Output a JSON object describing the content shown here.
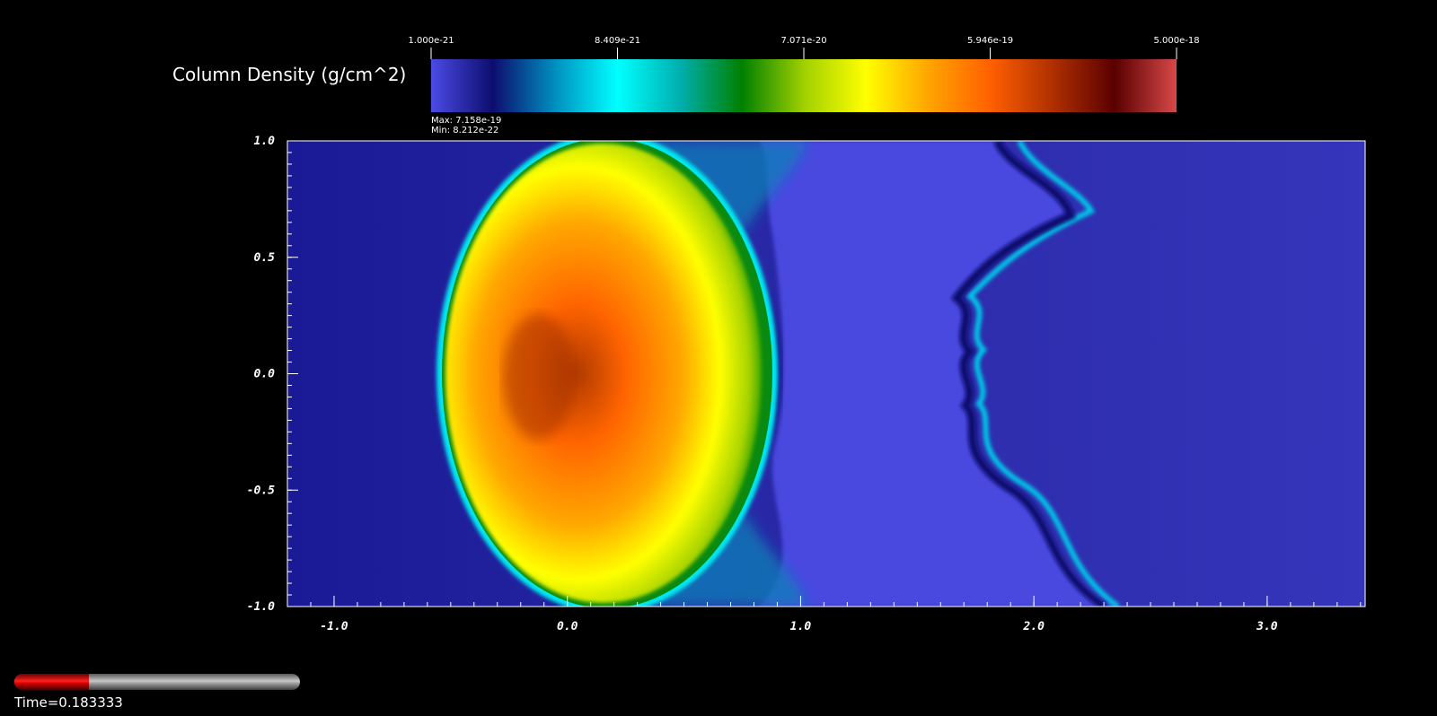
{
  "colorbar": {
    "title": "Column Density (g/cm^2)",
    "tick_labels": [
      "1.000e-21",
      "8.409e-21",
      "7.071e-20",
      "5.946e-19",
      "5.000e-18"
    ],
    "max_label": "Max:  7.158e-19",
    "min_label": "Min:  8.212e-22",
    "colormap": [
      "#4b4be6",
      "#0d0d6e",
      "#0090c0",
      "#00ffff",
      "#00b0b0",
      "#008000",
      "#a0d000",
      "#ffff00",
      "#ffa500",
      "#ff6000",
      "#b03000",
      "#5a0000",
      "#d84848"
    ]
  },
  "chart_data": {
    "type": "heatmap",
    "title": "",
    "xlabel": "",
    "ylabel": "",
    "xlim": [
      -1.2,
      3.42
    ],
    "ylim": [
      -1.0,
      1.0
    ],
    "x_ticks": [
      "-1.0",
      "0.0",
      "1.0",
      "2.0",
      "3.0"
    ],
    "y_ticks": [
      "1.0",
      "0.5",
      "0.0",
      "-0.5",
      "-1.0"
    ],
    "x_tick_values": [
      -1.0,
      0.0,
      1.0,
      2.0,
      3.0
    ],
    "y_tick_values": [
      1.0,
      0.5,
      0.0,
      -0.5,
      -1.0
    ],
    "color_scale": "log",
    "color_range": [
      1e-21,
      5e-18
    ],
    "data_max": 7.158e-19,
    "data_min": 8.212e-22,
    "features": {
      "background_column_density": 2e-21,
      "cloud_peak_column_density": 4e-19,
      "cloud_peak_center": [
        -0.15,
        0.0
      ]
    },
    "grid": false
  },
  "time": {
    "label": "Time=0.183333",
    "progress": 0.26
  }
}
